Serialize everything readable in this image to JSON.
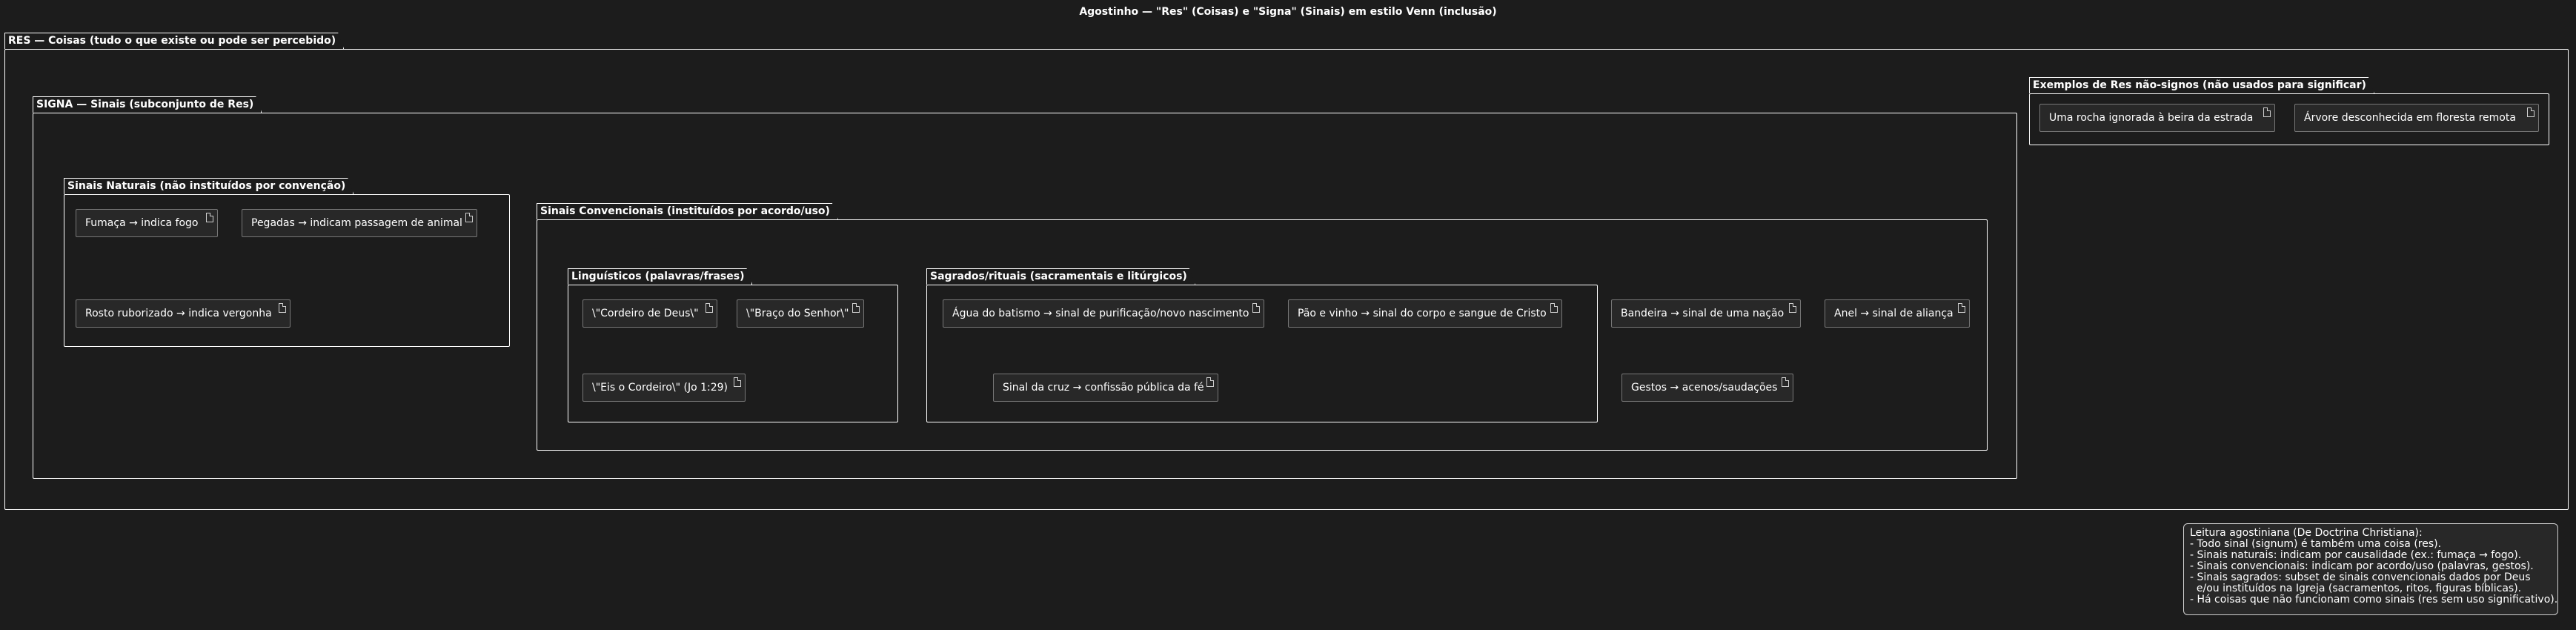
{
  "title": "Agostinho — \"Res\" (Coisas) e \"Signa\" (Sinais) em estilo Venn (inclusão)",
  "packages": {
    "res": "RES — Coisas (tudo o que existe ou pode ser percebido)",
    "signa": "SIGNA — Sinais (subconjunto de Res)",
    "naturais": "Sinais Naturais (não instituídos por convenção)",
    "convencionais": "Sinais Convencionais (instituídos por acordo/uso)",
    "linguisticos": "Linguísticos (palavras/frases)",
    "sagrados": "Sagrados/rituais (sacramentais e litúrgicos)",
    "nao_signos": "Exemplos de Res não-signos (não usados para significar)"
  },
  "nodes": {
    "fumaca": "Fumaça → indica fogo",
    "pegadas": "Pegadas → indicam passagem de animal",
    "rosto": "Rosto ruborizado → indica vergonha",
    "cordeiro": "\\\"Cordeiro de Deus\\\"",
    "braco": "\\\"Braço do Senhor\\\"",
    "eis": "\\\"Eis o Cordeiro\\\" (Jo 1:29)",
    "agua": "Água do batismo → sinal de purificação/novo nascimento",
    "pao": "Pão e vinho → sinal do corpo e sangue de Cristo",
    "cruz": "Sinal da cruz → confissão pública da fé",
    "bandeira": "Bandeira → sinal de uma nação",
    "anel": "Anel → sinal de aliança",
    "gestos": "Gestos → acenos/saudações",
    "rocha": "Uma rocha ignorada à beira da estrada",
    "arvore": "Árvore desconhecida em floresta remota"
  },
  "note": [
    "Leitura agostiniana (De Doctrina Christiana):",
    "- Todo sinal (signum) é também uma coisa (res).",
    "- Sinais naturais: indicam por causalidade (ex.: fumaça → fogo).",
    "- Sinais convencionais: indicam por acordo/uso (palavras, gestos).",
    "- Sinais sagrados: subset de sinais convencionais dados por Deus",
    "  e/ou instituídos na Igreja (sacramentos, ritos, figuras bíblicas).",
    "- Há coisas que não funcionam como sinais (res sem uso significativo)."
  ]
}
